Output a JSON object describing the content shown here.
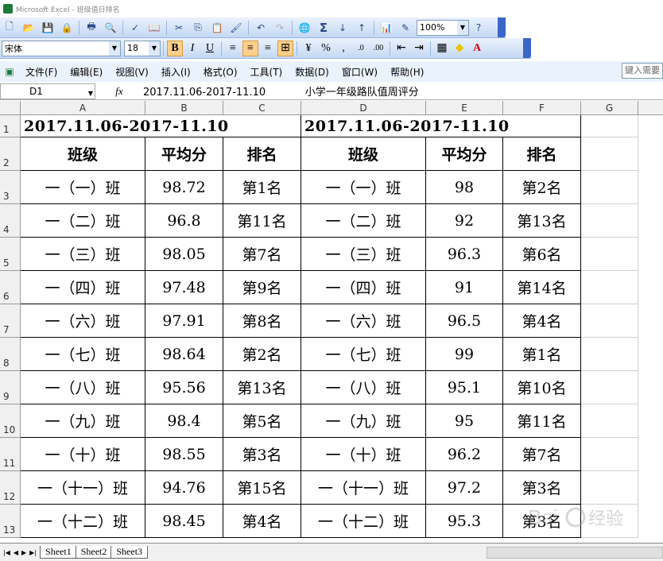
{
  "window": {
    "title": "Microsoft Excel - 班级值日排名"
  },
  "toolbar": {
    "zoom": "100%"
  },
  "format": {
    "font": "宋体",
    "size": "18"
  },
  "menu": [
    "文件(F)",
    "编辑(E)",
    "视图(V)",
    "插入(I)",
    "格式(O)",
    "工具(T)",
    "数据(D)",
    "窗口(W)",
    "帮助(H)"
  ],
  "help_placeholder": "键入需要",
  "namebox": "D1",
  "formula": "2017.11.06-2017-11.10            小学一年级路队值周评分",
  "columns": [
    "A",
    "B",
    "C",
    "D",
    "E",
    "F",
    "G"
  ],
  "rows": [
    "1",
    "2",
    "3",
    "4",
    "5",
    "6",
    "7",
    "8",
    "9",
    "10",
    "11",
    "12",
    "13"
  ],
  "sheet": {
    "title_left": "2017.11.06-2017-11.10",
    "title_right": "2017.11.06-2017-11.10",
    "headers": [
      "班级",
      "平均分",
      "排名",
      "班级",
      "平均分",
      "排名"
    ],
    "data": [
      [
        "一（一）班",
        "98.72",
        "第1名",
        "一（一）班",
        "98",
        "第2名"
      ],
      [
        "一（二）班",
        "96.8",
        "第11名",
        "一（二）班",
        "92",
        "第13名"
      ],
      [
        "一（三）班",
        "98.05",
        "第7名",
        "一（三）班",
        "96.3",
        "第6名"
      ],
      [
        "一（四）班",
        "97.48",
        "第9名",
        "一（四）班",
        "91",
        "第14名"
      ],
      [
        "一（六）班",
        "97.91",
        "第8名",
        "一（六）班",
        "96.5",
        "第4名"
      ],
      [
        "一（七）班",
        "98.64",
        "第2名",
        "一（七）班",
        "99",
        "第1名"
      ],
      [
        "一（八）班",
        "95.56",
        "第13名",
        "一（八）班",
        "95.1",
        "第10名"
      ],
      [
        "一（九）班",
        "98.4",
        "第5名",
        "一（九）班",
        "95",
        "第11名"
      ],
      [
        "一（十）班",
        "98.55",
        "第3名",
        "一（十）班",
        "96.2",
        "第7名"
      ],
      [
        "一（十一）班",
        "94.76",
        "第15名",
        "一（十一）班",
        "97.2",
        "第3名"
      ],
      [
        "一（十二）班",
        "98.45",
        "第4名",
        "一（十二）班",
        "95.3",
        "第3名"
      ]
    ]
  },
  "tabs": [
    "Sheet1",
    "Sheet2",
    "Sheet3"
  ],
  "watermark": "Baidu 经验"
}
